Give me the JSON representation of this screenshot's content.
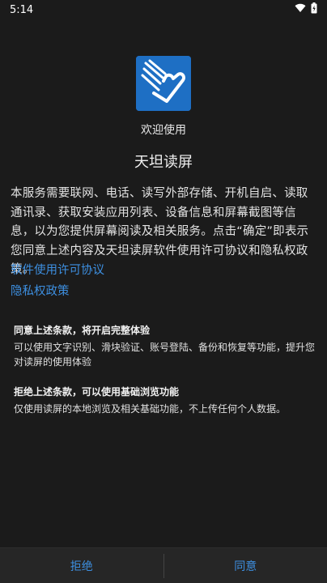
{
  "status_bar": {
    "time": "5:14",
    "wifi_icon": "wifi-icon",
    "battery_icon": "battery-charging-icon"
  },
  "app": {
    "logo_icon": "tiantan-logo-icon",
    "welcome": "欢迎使用",
    "name": "天坦读屏",
    "brand_color": "#1e6fc4"
  },
  "intro_text": "本服务需要联网、电话、读写外部存储、开机自启、读取通讯录、获取安装应用列表、设备信息和屏幕截图等信息，以为您提供屏幕阅读及相关服务。点击“确定”即表示您同意上述内容及天坦读屏软件使用许可协议和隐私权政策。",
  "links": {
    "license": "软件使用许可协议",
    "privacy": "隐私权政策",
    "link_color": "#3d8fe0"
  },
  "options": {
    "agree_title": "同意上述条款，将开启完整体验",
    "agree_desc": "可以使用文字识别、滑块验证、账号登陆、备份和恢复等功能，提升您对读屏的使用体验",
    "reject_title": "拒绝上述条款，可以使用基础浏览功能",
    "reject_desc": "仅使用读屏的本地浏览及相关基础功能，不上传任何个人数据。"
  },
  "buttons": {
    "reject": "拒绝",
    "agree": "同意"
  }
}
